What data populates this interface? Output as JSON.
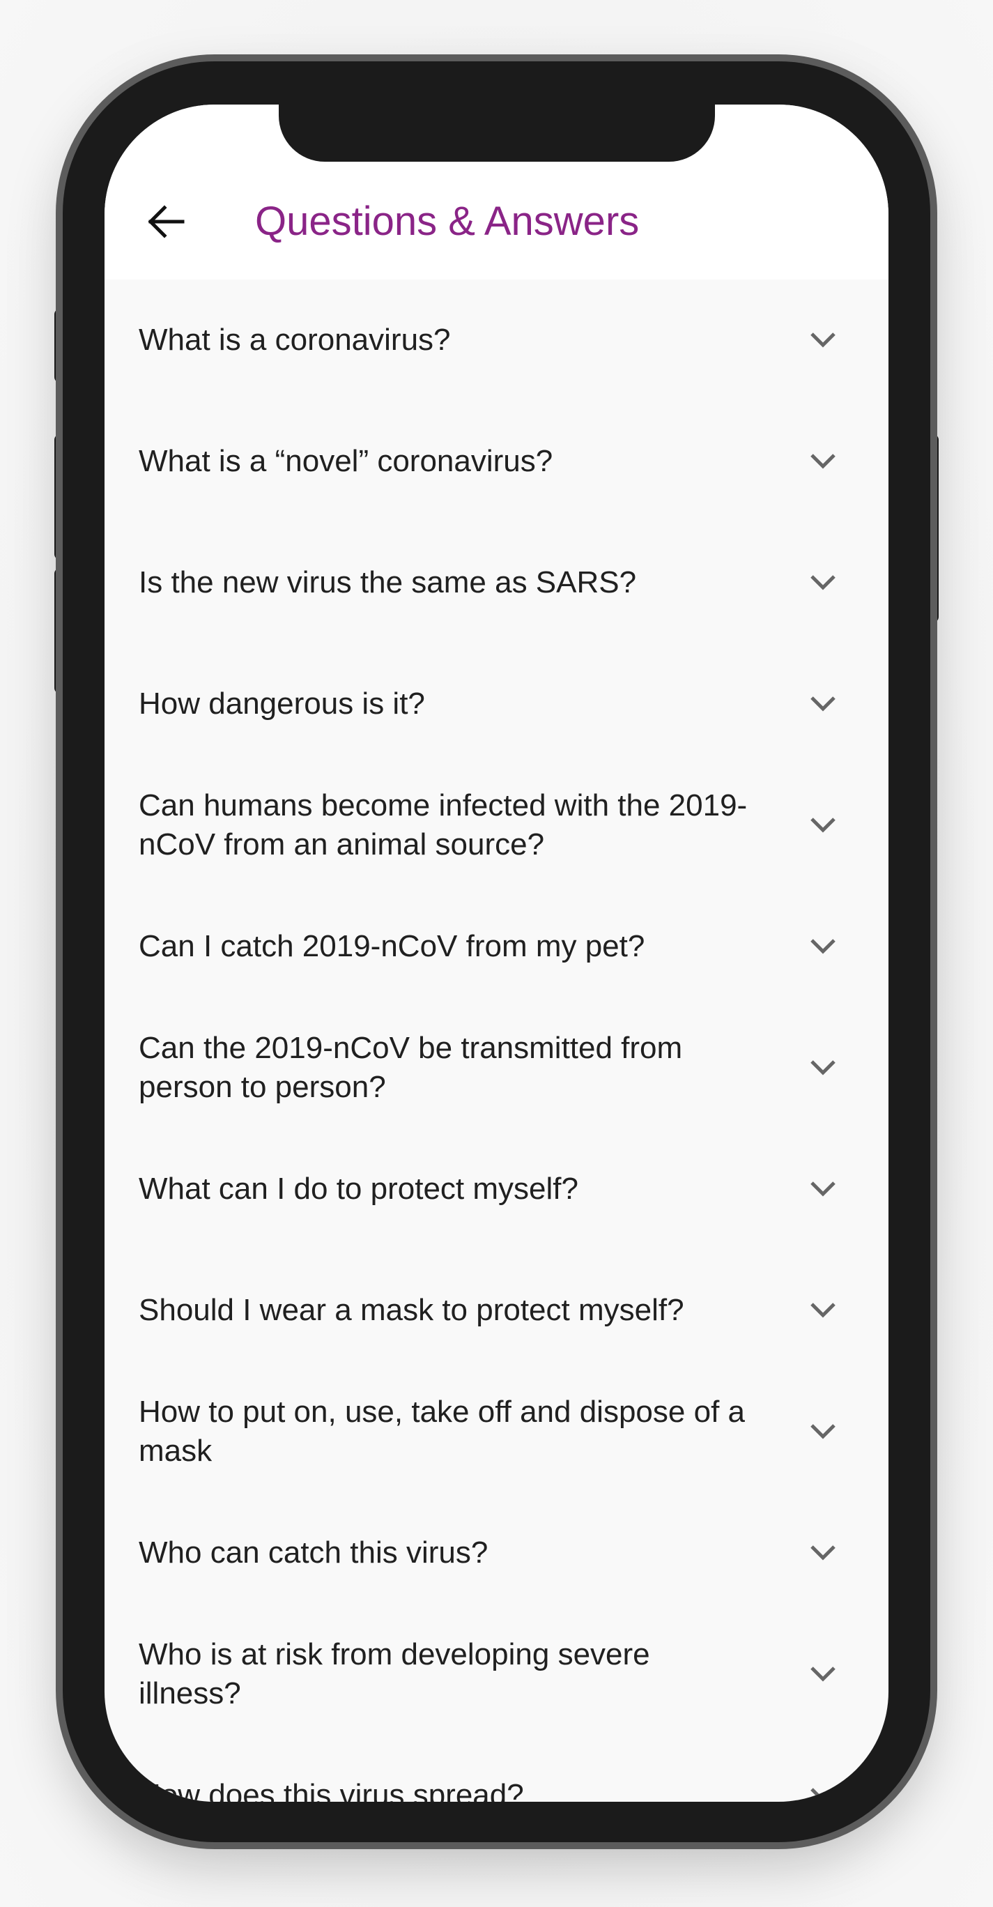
{
  "header": {
    "title": "Questions & Answers"
  },
  "faq": [
    {
      "question": "What is a coronavirus?"
    },
    {
      "question": "What is a “novel” coronavirus?"
    },
    {
      "question": "Is the new virus the same as SARS?"
    },
    {
      "question": "How dangerous is it?"
    },
    {
      "question": "Can humans become infected with the 2019-nCoV from an animal source?"
    },
    {
      "question": "Can I catch 2019-nCoV from my pet?"
    },
    {
      "question": "Can the 2019-nCoV be transmitted from person to person?"
    },
    {
      "question": "What can I do to protect myself?"
    },
    {
      "question": "Should I wear a mask to protect myself?"
    },
    {
      "question": "How to put on, use, take off and dispose of a mask"
    },
    {
      "question": "Who can catch this virus?"
    },
    {
      "question": "Who is at risk from developing severe illness?"
    },
    {
      "question": "How does this virus spread?"
    }
  ],
  "icons": {
    "back": "arrow-left-icon",
    "expand": "chevron-down-icon"
  },
  "colors": {
    "title": "#8a2487",
    "text": "#202020",
    "chevron": "#666666",
    "list_background": "#f9f9f9",
    "header_background": "#ffffff"
  }
}
